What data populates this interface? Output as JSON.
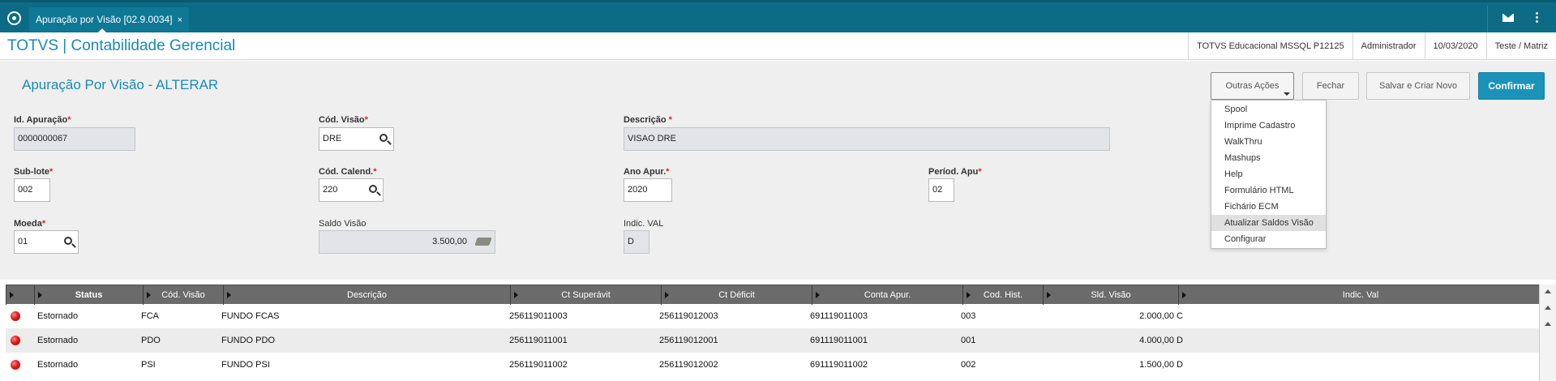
{
  "tab": {
    "title": "Apuração por Visão [02.9.0034]",
    "close": "×"
  },
  "header": {
    "brand": "TOTVS | Contabilidade Gerencial",
    "environment": "TOTVS Educacional MSSQL P12125",
    "user": "Administrador",
    "date": "10/03/2020",
    "branch": "Teste / Matriz"
  },
  "page": {
    "title": "Apuração Por Visão - ALTERAR"
  },
  "actions": {
    "outras": "Outras Ações",
    "fechar": "Fechar",
    "salvar": "Salvar e Criar Novo",
    "confirmar": "Confirmar"
  },
  "menu": [
    "Spool",
    "Imprime Cadastro",
    "WalkThru",
    "Mashups",
    "Help",
    "Formulário HTML",
    "Fichário ECM",
    "Atualizar Saldos Visão",
    "Configurar"
  ],
  "form": {
    "id_apuracao": {
      "label": "Id. Apuração",
      "value": "0000000067"
    },
    "cod_visao": {
      "label": "Cód. Visão",
      "value": "DRE"
    },
    "descricao": {
      "label": "Descrição ",
      "value": "VISAO DRE"
    },
    "sub_lote": {
      "label": "Sub-lote",
      "value": "002"
    },
    "cod_calend": {
      "label": "Cód. Calend.",
      "value": "220"
    },
    "ano_apur": {
      "label": "Ano Apur.",
      "value": "2020"
    },
    "period_apu": {
      "label": "Períod.  Apu",
      "value": "02"
    },
    "moeda": {
      "label": "Moeda",
      "value": "01"
    },
    "saldo_visao": {
      "label": "Saldo Visão",
      "value": "3.500,00"
    },
    "indic_val": {
      "label": "Indic. VAL",
      "value": "D"
    },
    "required_mark": "*"
  },
  "grid": {
    "columns": [
      "Status",
      "Cód. Visão",
      "Descrição",
      "Ct Superávit",
      "Ct Déficit",
      "Conta Apur.",
      "Cod. Hist.",
      "Sld. Visão",
      "Indic. Val"
    ],
    "rows": [
      [
        "Estornado",
        "FCA",
        "FUNDO FCAS",
        "256119011003",
        "256119012003",
        "691119011003",
        "003",
        "2.000,00",
        "C"
      ],
      [
        "Estornado",
        "PDO",
        "FUNDO PDO",
        "256119011001",
        "256119012001",
        "691119011001",
        "001",
        "4.000,00",
        "D"
      ],
      [
        "Estornado",
        "PSI",
        "FUNDO PSI",
        "256119011002",
        "256119012002",
        "691119011002",
        "002",
        "1.500,00",
        "D"
      ]
    ]
  }
}
